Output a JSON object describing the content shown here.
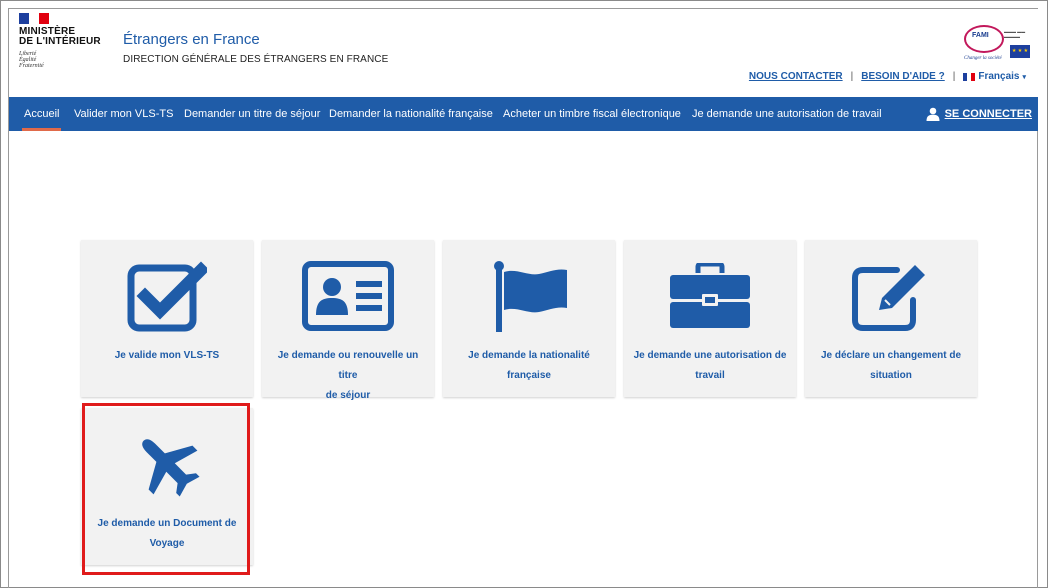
{
  "header": {
    "ministry_line1": "MINISTÈRE",
    "ministry_line2": "DE L'INTÉRIEUR",
    "motto": [
      "Liberté",
      "Égalité",
      "Fraternité"
    ],
    "site_title": "Étrangers en France",
    "site_subtitle": "DIRECTION GÉNÉRALE DES ÉTRANGERS EN FRANCE",
    "fami_logo_text": "FAMI",
    "fami_tagline": "Changer la société",
    "links": {
      "contact": "NOUS CONTACTER",
      "help": "BESOIN D'AIDE ?",
      "language": "Français",
      "separator": "|"
    }
  },
  "nav": {
    "items": [
      {
        "label": "Accueil",
        "active": true
      },
      {
        "label": "Valider mon VLS-TS"
      },
      {
        "label": "Demander un titre de séjour"
      },
      {
        "label": "Demander la nationalité française"
      },
      {
        "label": "Acheter un timbre fiscal électronique"
      },
      {
        "label": "Je demande une autorisation de travail"
      }
    ],
    "connect_label": "SE CONNECTER"
  },
  "tiles": [
    {
      "icon": "checkbox-check-icon",
      "line1": "Je valide mon VLS-TS",
      "line2": ""
    },
    {
      "icon": "id-card-icon",
      "line1": "Je demande ou renouvelle un titre",
      "line2": "de séjour"
    },
    {
      "icon": "flag-icon",
      "line1": "Je demande la nationalité",
      "line2": "française"
    },
    {
      "icon": "briefcase-icon",
      "line1": "Je demande une autorisation de",
      "line2": "travail"
    },
    {
      "icon": "edit-pencil-icon",
      "line1": "Je déclare un changement de",
      "line2": "situation"
    },
    {
      "icon": "airplane-icon",
      "line1": "Je demande un Document de",
      "line2": "Voyage"
    }
  ],
  "colors": {
    "brand_blue": "#1f5ca8",
    "nav_blue": "#1f5ca8",
    "active_underline": "#e06a4a",
    "highlight_red": "#e01b1b",
    "tile_bg": "#f2f2f2"
  }
}
